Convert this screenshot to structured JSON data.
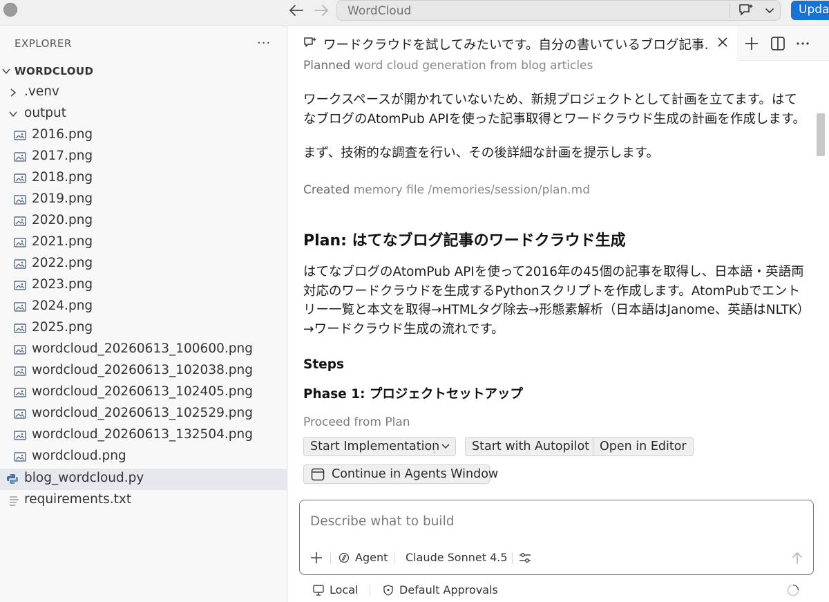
{
  "window": {
    "search_text": "WordCloud",
    "update_label": "Upda"
  },
  "explorer": {
    "header": "EXPLORER",
    "more": "···",
    "root": "WORDCLOUD",
    "items": [
      {
        "label": ".venv",
        "type": "folder",
        "expanded": false
      },
      {
        "label": "output",
        "type": "folder",
        "expanded": true
      },
      {
        "label": "2016.png",
        "type": "image"
      },
      {
        "label": "2017.png",
        "type": "image"
      },
      {
        "label": "2018.png",
        "type": "image"
      },
      {
        "label": "2019.png",
        "type": "image"
      },
      {
        "label": "2020.png",
        "type": "image"
      },
      {
        "label": "2021.png",
        "type": "image"
      },
      {
        "label": "2022.png",
        "type": "image"
      },
      {
        "label": "2023.png",
        "type": "image"
      },
      {
        "label": "2024.png",
        "type": "image"
      },
      {
        "label": "2025.png",
        "type": "image"
      },
      {
        "label": "wordcloud_20260613_100600.png",
        "type": "image"
      },
      {
        "label": "wordcloud_20260613_102038.png",
        "type": "image"
      },
      {
        "label": "wordcloud_20260613_102405.png",
        "type": "image"
      },
      {
        "label": "wordcloud_20260613_102529.png",
        "type": "image"
      },
      {
        "label": "wordcloud_20260613_132504.png",
        "type": "image"
      },
      {
        "label": "wordcloud.png",
        "type": "image"
      },
      {
        "label": "blog_wordcloud.py",
        "type": "python",
        "selected": true
      },
      {
        "label": "requirements.txt",
        "type": "text"
      }
    ]
  },
  "tab": {
    "title": "ワードクラウドを試してみたいです。自分の書いているブログ記事…"
  },
  "chat": {
    "planned_prefix": "Planned",
    "planned_text": "word cloud generation from blog articles",
    "para1": "ワークスペースが開かれていないため、新規プロジェクトとして計画を立てます。はてなブログのAtomPub APIを使った記事取得とワードクラウド生成の計画を作成します。",
    "para2": "まず、技術的な調査を行い、その後詳細な計画を提示します。",
    "created_prefix": "Created",
    "created_text": "memory file /memories/session/plan.md",
    "plan_title": "Plan: はてなブログ記事のワードクラウド生成",
    "plan_body": "はてなブログのAtomPub APIを使って2016年の45個の記事を取得し、日本語・英語両対応のワードクラウドを生成するPythonスクリプトを作成します。AtomPubでエントリー一覧と本文を取得→HTMLタグ除去→形態素解析（日本語はJanome、英語はNLTK）→ワードクラウド生成の流れです。",
    "steps_heading": "Steps",
    "phase1_heading": "Phase 1: プロジェクトセットアップ",
    "proceed_label": "Proceed from Plan",
    "buttons": {
      "start_impl": "Start Implementation",
      "start_autopilot": "Start with Autopilot",
      "open_editor": "Open in Editor",
      "continue_agents": "Continue in Agents Window"
    }
  },
  "input": {
    "placeholder": "Describe what to build",
    "agent": "Agent",
    "model": "Claude Sonnet 4.5"
  },
  "status": {
    "local": "Local",
    "approvals": "Default Approvals"
  }
}
